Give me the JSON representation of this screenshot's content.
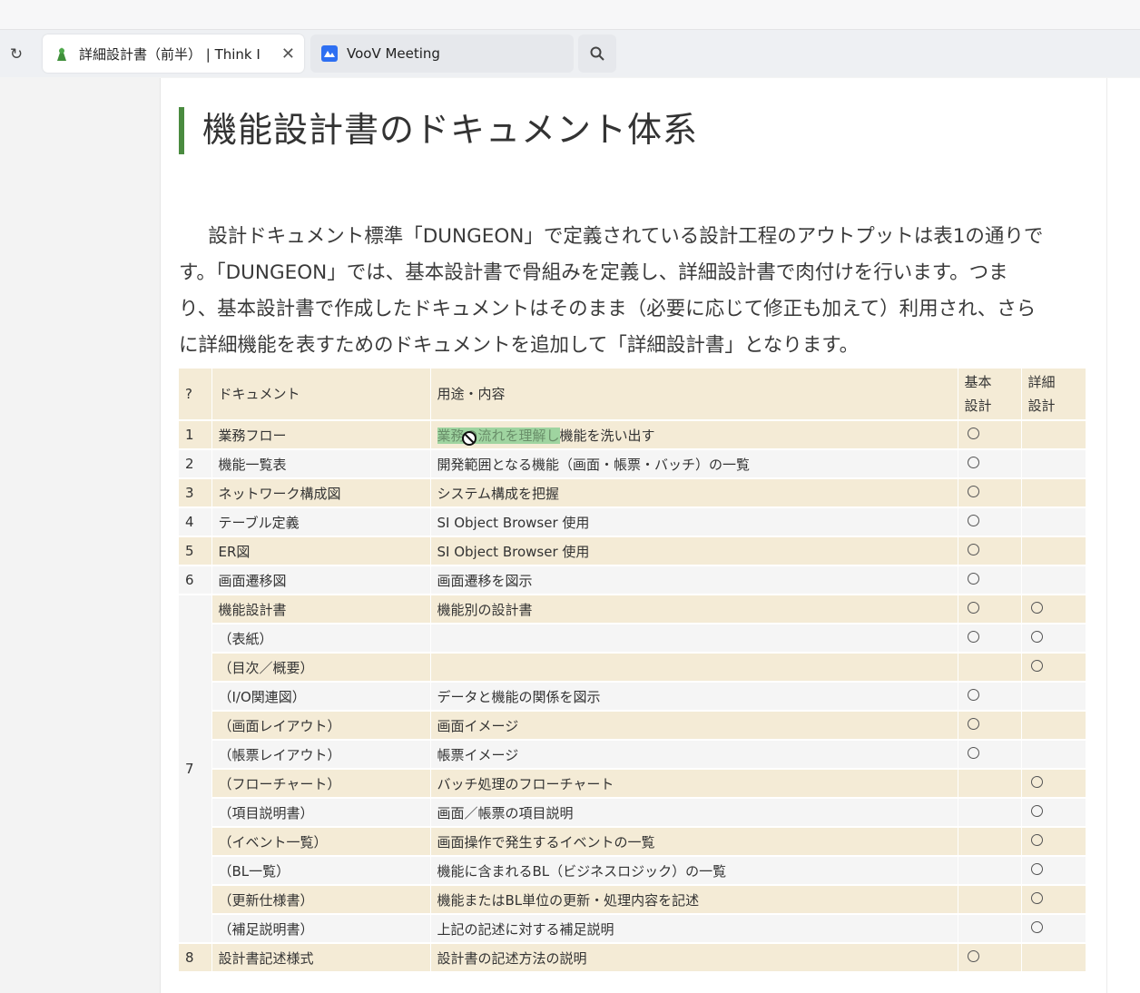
{
  "browser": {
    "reload_icon": "reload-icon",
    "tabs": [
      {
        "title": "詳細設計書（前半） | Think I",
        "favicon": "thinkit-icon",
        "active": true
      },
      {
        "title": "VooV Meeting",
        "favicon": "voov-icon",
        "active": false
      }
    ],
    "search_icon": "search-icon"
  },
  "article": {
    "heading": "機能設計書のドキュメント体系",
    "accent_color": "#4a8b3f",
    "paragraph_lines": [
      "設計ドキュメント標準「DUNGEON」で定義されている設計工程のアウトプットは表1の通りで",
      "す。「DUNGEON」では、基本設計書で骨組みを定義し、詳細設計書で肉付けを行います。つま",
      "り、基本設計書で作成したドキュメントはそのまま（必要に応じて修正も加えて）利用され、さら",
      "に詳細機能を表すためのドキュメントを追加して「詳細設計書」となります。"
    ]
  },
  "table": {
    "header": {
      "num": "?",
      "doc": "ドキュメント",
      "use": "用途・内容",
      "basic_1": "基本",
      "basic_2": "設計",
      "detail_1": "詳細",
      "detail_2": "設計"
    },
    "row_fill_color": "#f4ebd6",
    "rows": [
      {
        "num": "1",
        "doc": "業務フロー",
        "use_highlight": "業務の流れを理解し",
        "use": "機能を洗い出す",
        "basic": true,
        "detail": false
      },
      {
        "num": "2",
        "doc": "機能一覧表",
        "use": "開発範囲となる機能（画面・帳票・バッチ）の一覧",
        "basic": true,
        "detail": false
      },
      {
        "num": "3",
        "doc": "ネットワーク構成図",
        "use": "システム構成を把握",
        "basic": true,
        "detail": false
      },
      {
        "num": "4",
        "doc": "テーブル定義",
        "use": "SI Object Browser 使用",
        "basic": true,
        "detail": false
      },
      {
        "num": "5",
        "doc": "ER図",
        "use": "SI Object Browser 使用",
        "basic": true,
        "detail": false
      },
      {
        "num": "6",
        "doc": "画面遷移図",
        "use": "画面遷移を図示",
        "basic": true,
        "detail": false
      },
      {
        "num": "7",
        "doc": "機能設計書",
        "use": "機能別の設計書",
        "basic": true,
        "detail": true
      },
      {
        "num": "",
        "doc": "（表紙）",
        "use": "",
        "basic": true,
        "detail": true
      },
      {
        "num": "",
        "doc": "（目次／概要）",
        "use": "",
        "basic": false,
        "detail": true
      },
      {
        "num": "",
        "doc": "（I/O関連図）",
        "use": "データと機能の関係を図示",
        "basic": true,
        "detail": false
      },
      {
        "num": "",
        "doc": "（画面レイアウト）",
        "use": "画面イメージ",
        "basic": true,
        "detail": false
      },
      {
        "num": "",
        "doc": "（帳票レイアウト）",
        "use": "帳票イメージ",
        "basic": true,
        "detail": false
      },
      {
        "num": "",
        "doc": "（フローチャート）",
        "use": "バッチ処理のフローチャート",
        "basic": false,
        "detail": true
      },
      {
        "num": "",
        "doc": "（項目説明書）",
        "use": "画面／帳票の項目説明",
        "basic": false,
        "detail": true
      },
      {
        "num": "",
        "doc": "（イベント一覧）",
        "use": "画面操作で発生するイベントの一覧",
        "basic": false,
        "detail": true
      },
      {
        "num": "",
        "doc": "（BL一覧）",
        "use": "機能に含まれるBL（ビジネスロジック）の一覧",
        "basic": false,
        "detail": true
      },
      {
        "num": "",
        "doc": "（更新仕様書）",
        "use": "機能またはBL単位の更新・処理内容を記述",
        "basic": false,
        "detail": true
      },
      {
        "num": "",
        "doc": "（補足説明書）",
        "use": "上記の記述に対する補足説明",
        "basic": false,
        "detail": true
      },
      {
        "num": "8",
        "doc": "設計書記述様式",
        "use": "設計書の記述方法の説明",
        "basic": true,
        "detail": false
      }
    ]
  }
}
